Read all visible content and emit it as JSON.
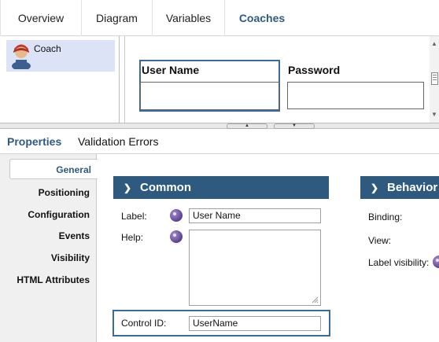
{
  "tabs": [
    {
      "label": "Overview"
    },
    {
      "label": "Diagram"
    },
    {
      "label": "Variables"
    },
    {
      "label": "Coaches",
      "active": true
    }
  ],
  "outline": {
    "coach_item": {
      "label": "Coach",
      "icon": "person-avatar-icon"
    }
  },
  "canvas": {
    "fields": [
      {
        "label": "User Name",
        "value": "",
        "selected": true
      },
      {
        "label": "Password",
        "value": ""
      }
    ],
    "scroll_icons": [
      "up-arrow",
      "grip",
      "down-arrow"
    ]
  },
  "splitter": {
    "collapse_up_icon": "triangle-up-icon",
    "collapse_down_icon": "triangle-down-icon"
  },
  "property_tabs": [
    {
      "label": "Properties",
      "active": true
    },
    {
      "label": "Validation Errors"
    }
  ],
  "left_nav": [
    {
      "label": "General",
      "active": true
    },
    {
      "label": "Positioning"
    },
    {
      "label": "Configuration"
    },
    {
      "label": "Events"
    },
    {
      "label": "Visibility"
    },
    {
      "label": "HTML Attributes"
    }
  ],
  "common": {
    "header": "Common",
    "label_field": {
      "label": "Label:",
      "value": "User Name"
    },
    "help_field": {
      "label": "Help:",
      "value": ""
    },
    "control_id": {
      "label": "Control ID:",
      "value": "UserName"
    }
  },
  "behavior": {
    "header": "Behavior",
    "binding": {
      "label": "Binding:"
    },
    "view": {
      "label": "View:"
    },
    "label_visibility": {
      "label": "Label visibility:"
    }
  },
  "colors": {
    "accent": "#2f5a84",
    "section_header": "#2f5a7f",
    "selection_outline": "#3d6a98",
    "outline_selection_bg": "#dde3f7",
    "help_icon": "#5b3f8e"
  }
}
